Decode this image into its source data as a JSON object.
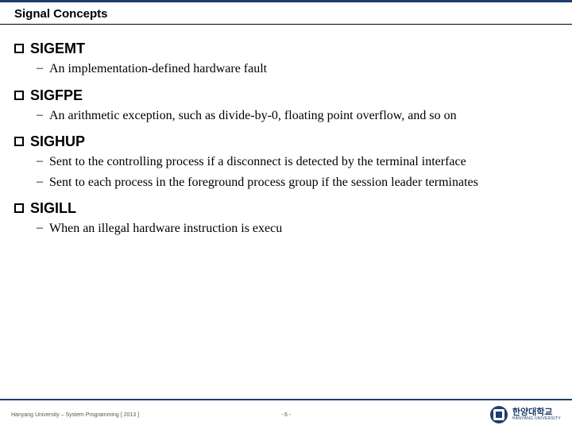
{
  "header": {
    "title": "Signal Concepts"
  },
  "items": [
    {
      "name": "SIGEMT",
      "subs": [
        "An implementation-defined hardware fault"
      ]
    },
    {
      "name": "SIGFPE",
      "subs": [
        "An arithmetic exception, such as divide-by-0, floating point overflow, and so on"
      ]
    },
    {
      "name": "SIGHUP",
      "subs": [
        "Sent to the controlling process if a disconnect is detected by the terminal interface",
        "Sent to each process in the foreground process group if the session leader terminates"
      ]
    },
    {
      "name": "SIGILL",
      "subs": [
        "When an illegal hardware instruction is execu"
      ]
    }
  ],
  "footer": {
    "left": "Hanyang University – System Programming [ 2013 ]",
    "page_prefix": "- ",
    "page_number": "6",
    "page_suffix": " -",
    "logo_kr": "한양대학교",
    "logo_en": "HANYANG UNIVERSITY"
  }
}
